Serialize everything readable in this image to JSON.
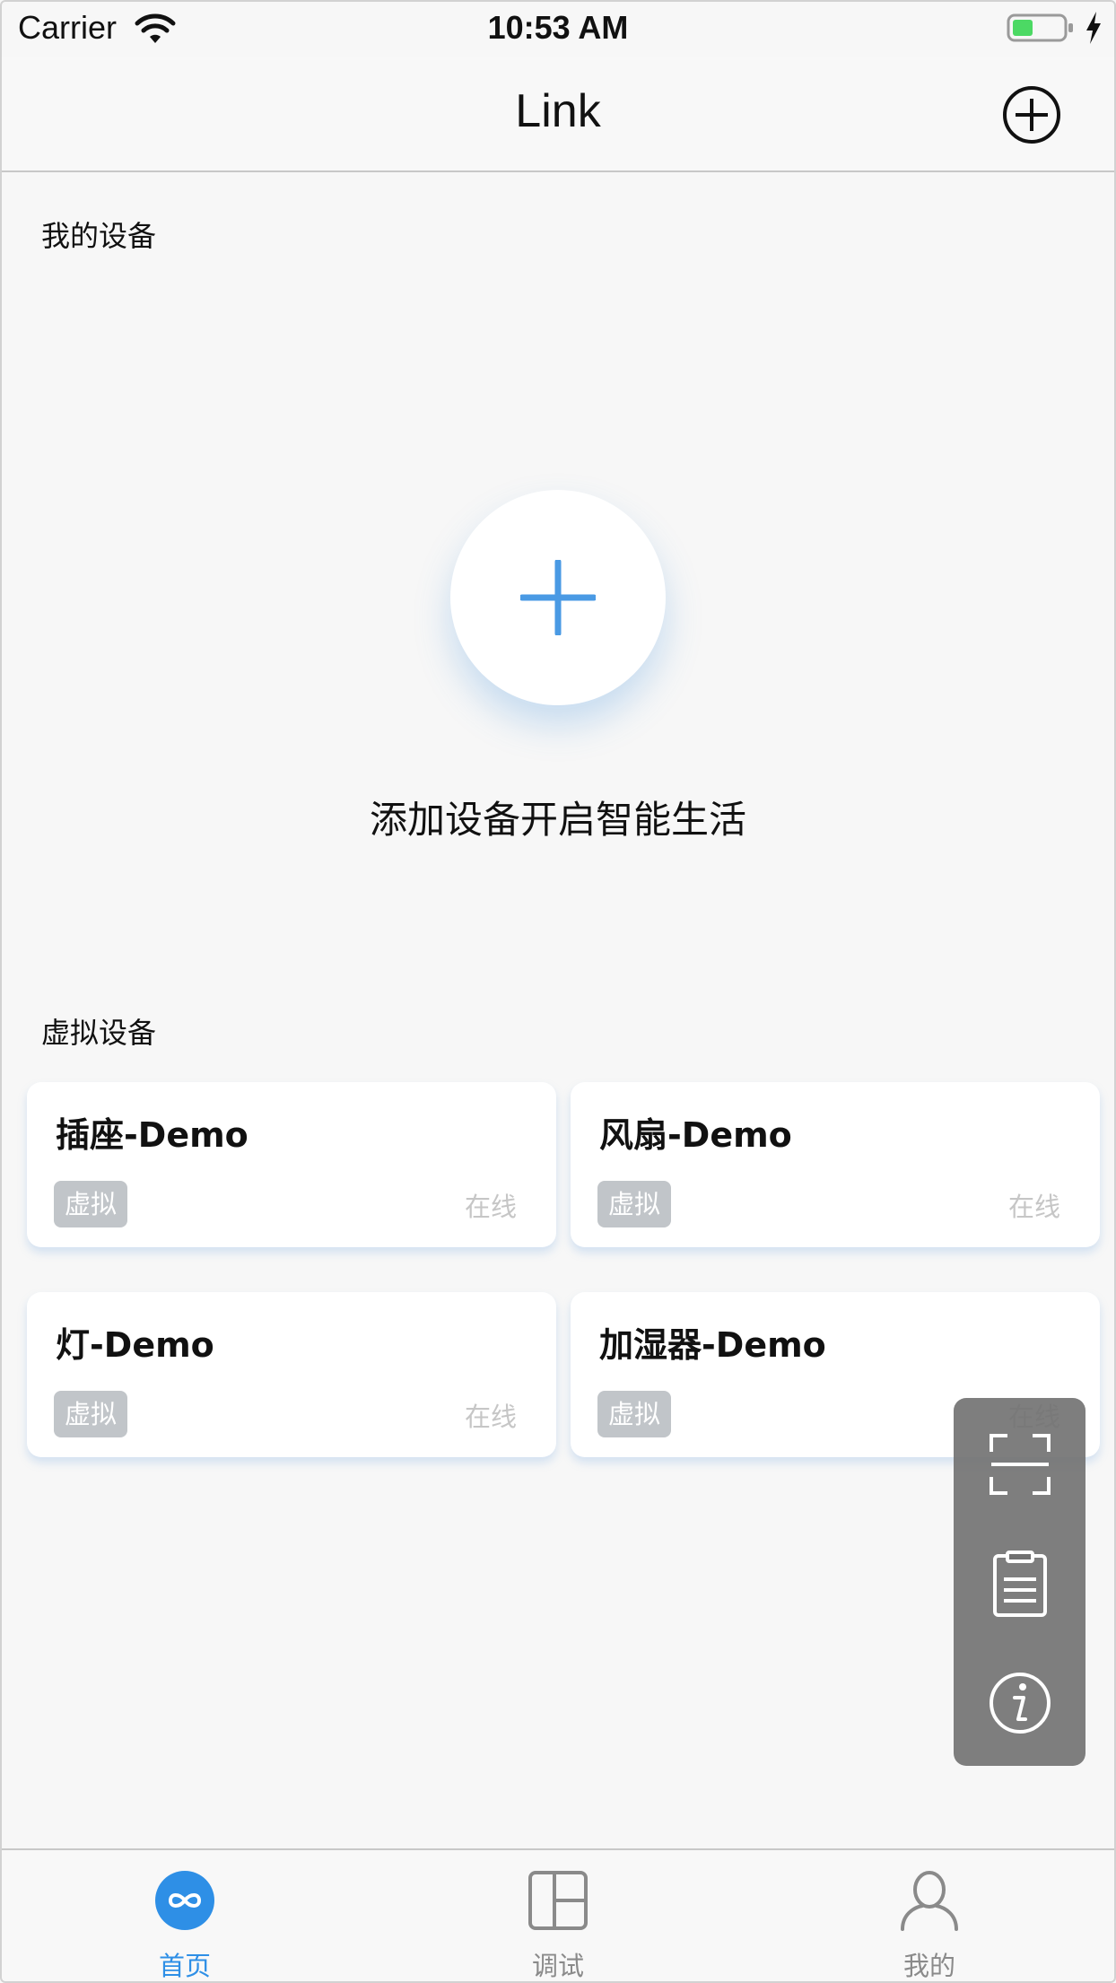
{
  "status_bar": {
    "carrier": "Carrier",
    "time": "10:53 AM"
  },
  "nav": {
    "title": "Link",
    "add_icon": "circle-plus-icon"
  },
  "my_devices": {
    "title": "我的设备",
    "empty_hint": "添加设备开启智能生活",
    "add_icon": "plus-icon"
  },
  "virtual_devices": {
    "title": "虚拟设备",
    "cards": [
      {
        "name": "插座-Demo",
        "badge": "虚拟",
        "status": "在线"
      },
      {
        "name": "风扇-Demo",
        "badge": "虚拟",
        "status": "在线"
      },
      {
        "name": "灯-Demo",
        "badge": "虚拟",
        "status": "在线"
      },
      {
        "name": "加湿器-Demo",
        "badge": "虚拟",
        "status": "在线"
      }
    ]
  },
  "tool_panel": {
    "icons": [
      "scan-icon",
      "clipboard-icon",
      "info-icon"
    ]
  },
  "tabs": [
    {
      "label": "首页",
      "icon": "infinity-icon",
      "active": true
    },
    {
      "label": "调试",
      "icon": "debug-panel-icon",
      "active": false
    },
    {
      "label": "我的",
      "icon": "person-icon",
      "active": false
    }
  ],
  "colors": {
    "accent": "#2e8fe6",
    "badge": "#c1c5c9",
    "panel": "#707070"
  }
}
